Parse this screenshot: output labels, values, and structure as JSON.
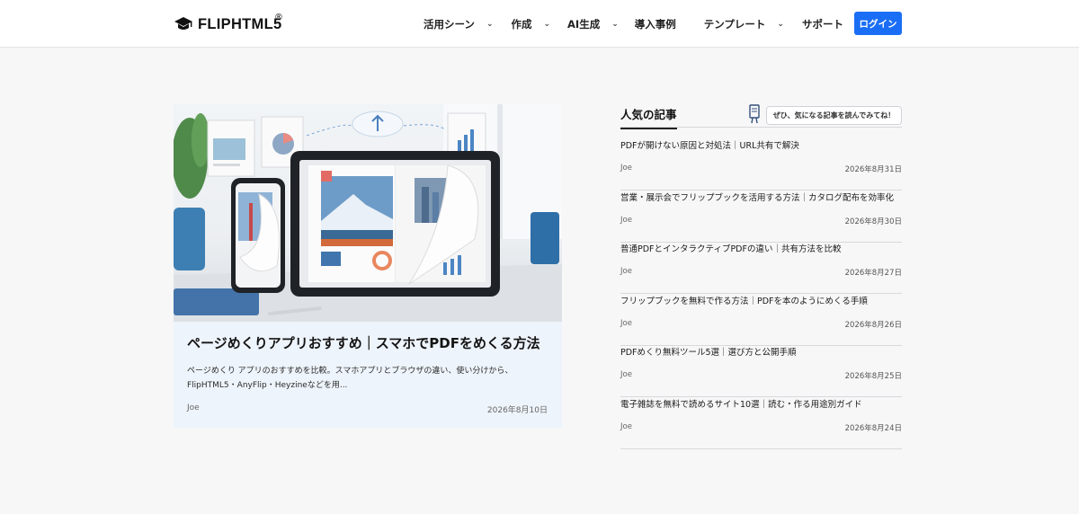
{
  "header": {
    "logo_text": "FLIPHTML5",
    "logo_reg": "®",
    "nav": [
      {
        "label": "活用シーン",
        "has_dropdown": true
      },
      {
        "label": "作成",
        "has_dropdown": true
      },
      {
        "label": "AI生成",
        "has_dropdown": true
      },
      {
        "label": "導入事例",
        "has_dropdown": false
      },
      {
        "label": "テンプレート",
        "has_dropdown": true
      },
      {
        "label": "サポート",
        "has_dropdown": true
      }
    ],
    "chevron": "⌄",
    "login_label": "ログイン"
  },
  "featured": {
    "title": "ページめくりアプリおすすめ｜スマホでPDFをめくる方法",
    "excerpt_line1": "ページめくり アプリのおすすめを比較。スマホアプリとブラウザの違い、使い分けから、",
    "excerpt_line2": "FlipHTML5・AnyFlip・Heyzineなどを用...",
    "author": "Joe",
    "date": "2026年8月10日"
  },
  "popular": {
    "title": "人気の記事",
    "bubble": "ぜひ、気になる記事を読んでみてね！",
    "articles": [
      {
        "title": "PDFが開けない原因と対処法｜URL共有で解決",
        "author": "Joe",
        "date": "2026年8月31日"
      },
      {
        "title": "営業・展示会でフリップブックを活用する方法｜カタログ配布を効率化",
        "author": "Joe",
        "date": "2026年8月30日"
      },
      {
        "title": "普通PDFとインタラクティブPDFの違い｜共有方法を比較",
        "author": "Joe",
        "date": "2026年8月27日"
      },
      {
        "title": "フリップブックを無料で作る方法｜PDFを本のようにめくる手順",
        "author": "Joe",
        "date": "2026年8月26日"
      },
      {
        "title": "PDFめくり無料ツール5選｜選び方と公開手順",
        "author": "Joe",
        "date": "2026年8月25日"
      },
      {
        "title": "電子雑誌を無料で読めるサイト10選｜読む・作る用途別ガイド",
        "author": "Joe",
        "date": "2026年8月24日"
      }
    ]
  },
  "colors": {
    "accent": "#1a6ef5",
    "card_bg": "#eef4fb",
    "page_bg": "#f7f7f8"
  }
}
